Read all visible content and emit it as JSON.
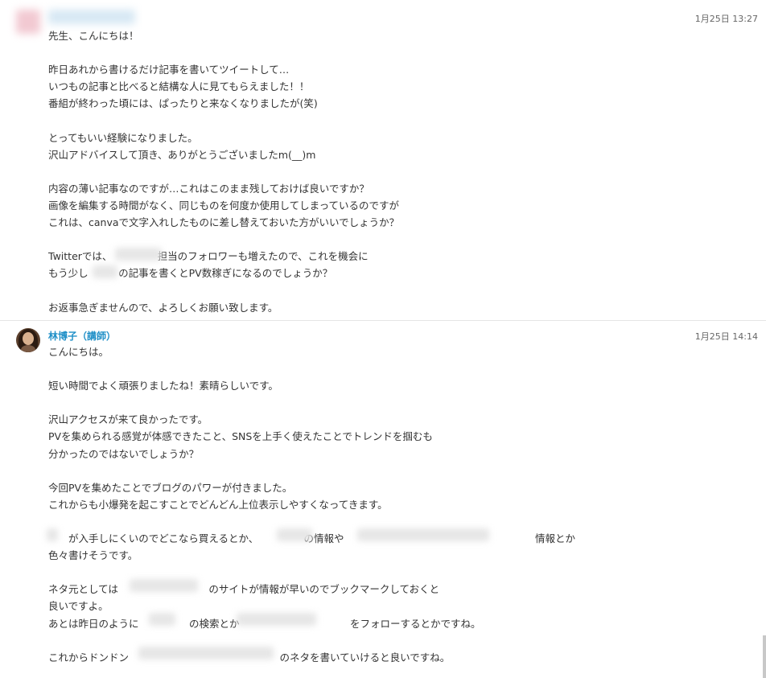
{
  "messages": [
    {
      "sender": "",
      "time": "1月25日 13:27",
      "lines": [
        "先生、こんにちは！",
        "",
        "昨日あれから書けるだけ記事を書いてツイートして…",
        "いつもの記事と比べると結構な人に見てもらえました！！",
        "番組が終わった頃には、ぱったりと来なくなりましたが(笑)",
        "",
        "とってもいい経験になりました。",
        "沢山アドバイスして頂き、ありがとうございましたm(__)m",
        "",
        "内容の薄い記事なのですが…これはこのまま残しておけば良いですか？",
        "画像を編集する時間がなく、同じものを何度か使用してしまっているのですが",
        "これは、canvaで文字入れしたものに差し替えておいた方がいいでしょうか？",
        "",
        "Twitterでは、　　　　　担当のフォロワーも増えたので、これを機会に",
        "もう少し　　　の記事を書くとPV数稼ぎになるのでしょうか？",
        "",
        "お返事急ぎませんので、よろしくお願い致します。"
      ]
    },
    {
      "sender": "林博子（講師）",
      "time": "1月25日 14:14",
      "lines": [
        "こんにちは。",
        "",
        "短い時間でよく頑張りましたね！素晴らしいです。",
        "",
        "沢山アクセスが来て良かったです。",
        "PVを集められる感覚が体感できたこと、SNSを上手く使えたことでトレンドを掴むも",
        "分かったのではないでしょうか？",
        "",
        "今回PVを集めたことでブログのパワーが付きました。",
        "これからも小爆発を起こすことでどんどん上位表示しやすくなってきます。",
        "",
        "　　が入手しにくいのでどこなら買えるとか、　　　　　の情報や　　　　　　　　　　　　　　　　　　　情報とか",
        "色々書けそうです。",
        "",
        "ネタ元としては　　　　　　　　　のサイトが情報が早いのでブックマークしておくと",
        "良いですよ。",
        "あとは昨日のように　　　　　の検索とか　　　　　　　　　　　をフォローするとかですね。",
        "",
        "これからドンドン　　　　　　　　　　　　　　　のネタを書いていけると良いですね。"
      ]
    }
  ]
}
